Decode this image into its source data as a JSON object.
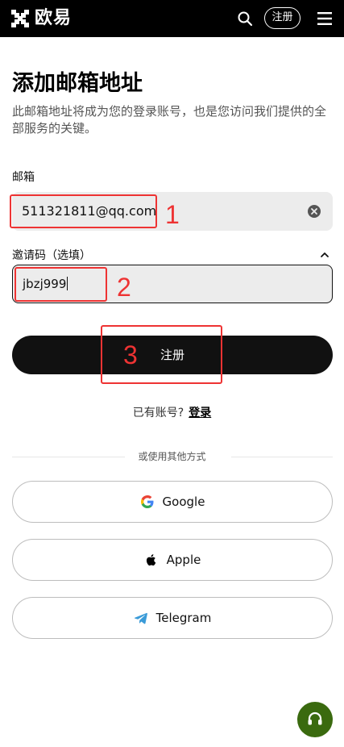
{
  "header": {
    "brand": "欧易",
    "register_label": "注册",
    "icons": {
      "logo": "okx-logo-icon",
      "search": "search-icon",
      "menu": "menu-icon"
    }
  },
  "page": {
    "title": "添加邮箱地址",
    "subtitle": "此邮箱地址将成为您的登录账号，也是您访问我们提供的全部服务的关键。"
  },
  "form": {
    "email_label": "邮箱",
    "email_value": "511321811@qq.com",
    "invite_label": "邀请码（选填）",
    "invite_value": "jbzj999",
    "submit_label": "注册"
  },
  "login": {
    "prompt": "已有账号?",
    "link_label": "登录"
  },
  "social": {
    "divider_text": "或使用其他方式",
    "buttons": [
      {
        "label": "Google",
        "icon": "google-icon"
      },
      {
        "label": "Apple",
        "icon": "apple-icon"
      },
      {
        "label": "Telegram",
        "icon": "telegram-icon"
      }
    ]
  },
  "annotations": {
    "n1": "1",
    "n2": "2",
    "n3": "3",
    "color": "#e33333"
  },
  "colors": {
    "header_bg": "#000000",
    "primary_button": "#111111",
    "input_bg": "#ececec",
    "support_fab": "#3a6a0f"
  }
}
